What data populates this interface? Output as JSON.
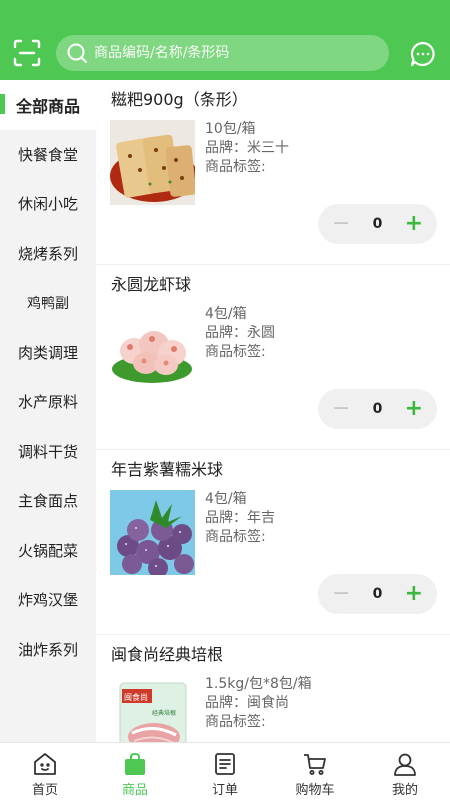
{
  "header": {
    "search_placeholder": "商品编码/名称/条形码"
  },
  "sidebar": {
    "items": [
      {
        "label": "全部商品"
      },
      {
        "label": "快餐食堂"
      },
      {
        "label": "休闲小吃"
      },
      {
        "label": "烧烤系列"
      },
      {
        "label": "鸡鸭副"
      },
      {
        "label": "肉类调理"
      },
      {
        "label": "水产原料"
      },
      {
        "label": "调料干货"
      },
      {
        "label": "主食面点"
      },
      {
        "label": "火锅配菜"
      },
      {
        "label": "炸鸡汉堡"
      },
      {
        "label": "油炸系列"
      }
    ]
  },
  "products": [
    {
      "name": "糍粑900g（条形）",
      "spec": "10包/箱",
      "brand": "品牌：米三十",
      "tags": "商品标签:",
      "qty": "0",
      "minus": "−",
      "plus": "+"
    },
    {
      "name": "永圆龙虾球",
      "spec": "4包/箱",
      "brand": "品牌：永圆",
      "tags": "商品标签:",
      "qty": "0",
      "minus": "−",
      "plus": "+"
    },
    {
      "name": "年吉紫薯糯米球",
      "spec": "4包/箱",
      "brand": "品牌：年吉",
      "tags": "商品标签:",
      "qty": "0",
      "minus": "−",
      "plus": "+"
    },
    {
      "name": "闽食尚经典培根",
      "spec": "1.5kg/包*8包/箱",
      "brand": "品牌：闽食尚",
      "tags": "商品标签:",
      "package_text": "闽食尚",
      "package_sub": "经典培根"
    }
  ],
  "tabbar": {
    "items": [
      {
        "label": "首页"
      },
      {
        "label": "商品"
      },
      {
        "label": "订单"
      },
      {
        "label": "购物车"
      },
      {
        "label": "我的"
      }
    ]
  },
  "colors": {
    "brand": "#4fc853",
    "sidebar_bg": "#f3f3f3",
    "plus": "#3db83f"
  },
  "icons": [
    "scan-icon",
    "search-icon",
    "chat-icon",
    "home-icon",
    "bag-icon",
    "order-icon",
    "cart-icon",
    "user-icon"
  ]
}
